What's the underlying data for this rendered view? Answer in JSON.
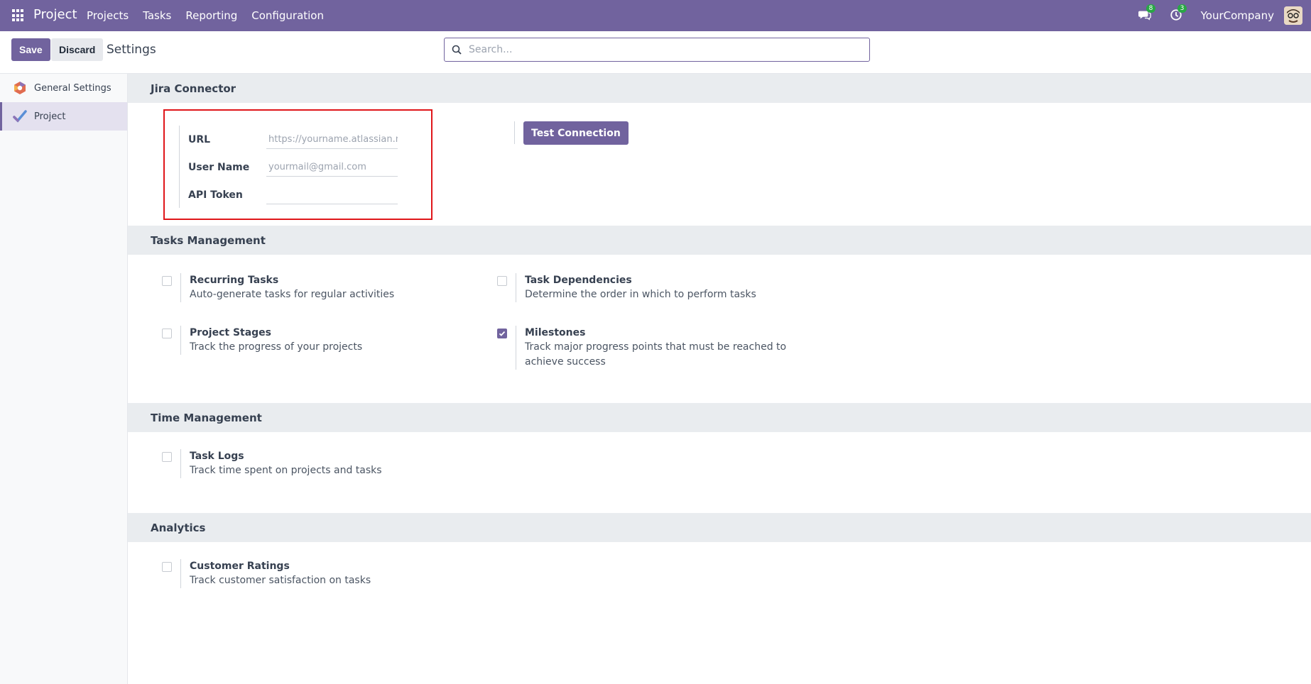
{
  "navbar": {
    "brand": "Project",
    "menu": [
      "Projects",
      "Tasks",
      "Reporting",
      "Configuration"
    ],
    "messages_count": "8",
    "activities_count": "3",
    "company": "YourCompany"
  },
  "control_panel": {
    "save_label": "Save",
    "discard_label": "Discard",
    "title": "Settings",
    "search_placeholder": "Search..."
  },
  "sidebar": {
    "items": [
      {
        "label": "General Settings",
        "icon": "odoo-logo-icon"
      },
      {
        "label": "Project",
        "icon": "project-check-icon",
        "active": true
      }
    ]
  },
  "jira": {
    "header": "Jira Connector",
    "url_label": "URL",
    "url_placeholder": "https://yourname.atlassian.net",
    "username_label": "User Name",
    "username_placeholder": "yourmail@gmail.com",
    "token_label": "API Token",
    "test_button": "Test Connection"
  },
  "tasks": {
    "header": "Tasks Management",
    "items": [
      {
        "title": "Recurring Tasks",
        "desc": "Auto-generate tasks for regular activities",
        "checked": false
      },
      {
        "title": "Task Dependencies",
        "desc": "Determine the order in which to perform tasks",
        "checked": false
      },
      {
        "title": "Project Stages",
        "desc": "Track the progress of your projects",
        "checked": false
      },
      {
        "title": "Milestones",
        "desc": "Track major progress points that must be reached to achieve success",
        "checked": true
      }
    ]
  },
  "time": {
    "header": "Time Management",
    "items": [
      {
        "title": "Task Logs",
        "desc": "Track time spent on projects and tasks",
        "checked": false
      }
    ]
  },
  "analytics": {
    "header": "Analytics",
    "items": [
      {
        "title": "Customer Ratings",
        "desc": "Track customer satisfaction on tasks",
        "checked": false
      }
    ]
  },
  "colors": {
    "brand": "#71639e",
    "highlight": "#e0161a",
    "badge": "#28a745"
  }
}
